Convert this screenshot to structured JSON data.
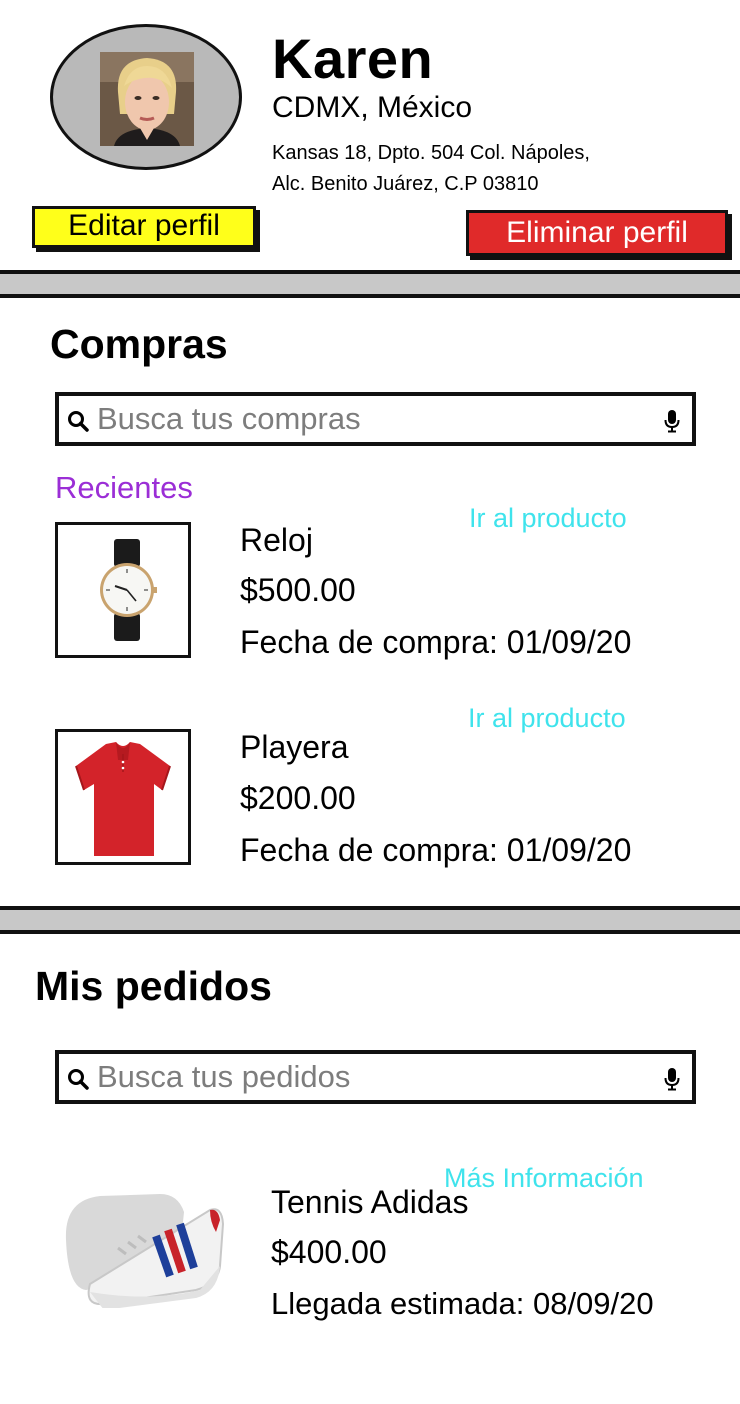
{
  "profile": {
    "name": "Karen",
    "city": "CDMX, México",
    "address_line1": "Kansas 18, Dpto. 504 Col. Nápoles,",
    "address_line2": "Alc. Benito Juárez, C.P 03810",
    "edit_label": "Editar perfil",
    "delete_label": "Eliminar perfil"
  },
  "purchases": {
    "title": "Compras",
    "search_placeholder": "Busca tus compras",
    "recent_label": "Recientes",
    "items": [
      {
        "name": "Reloj",
        "price": "$500.00",
        "date": "Fecha de compra: 01/09/20",
        "link": "Ir al producto",
        "image_icon": "watch-icon"
      },
      {
        "name": "Playera",
        "price": "$200.00",
        "date": "Fecha de compra: 01/09/20",
        "link": "Ir al producto",
        "image_icon": "tshirt-icon"
      }
    ]
  },
  "orders": {
    "title": "Mis pedidos",
    "search_placeholder": "Busca tus pedidos",
    "items": [
      {
        "name": "Tennis Adidas",
        "price": "$400.00",
        "arrival": "Llegada estimada: 08/09/20",
        "link": "Más Información",
        "image_icon": "sneaker-icon"
      }
    ]
  },
  "colors": {
    "edit_button": "#ffff1a",
    "delete_button": "#e02a2a",
    "recent_label": "#9b2ed6",
    "link": "#3fe3ec",
    "divider": "#c8c8c8"
  }
}
